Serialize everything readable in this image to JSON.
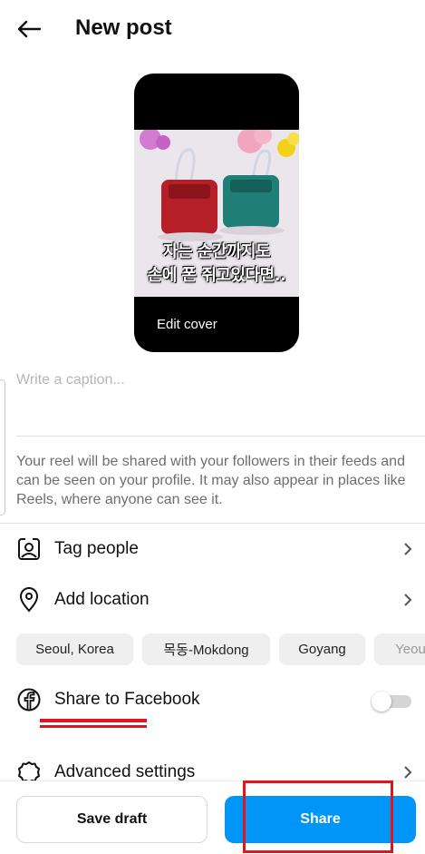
{
  "header": {
    "title": "New post",
    "back_icon": "arrow-left-icon"
  },
  "cover": {
    "overlay_line1": "자는 순간까지도",
    "overlay_line2": "손에 폰 쥐고있다면..",
    "edit_label": "Edit cover"
  },
  "caption": {
    "placeholder": "Write a caption..."
  },
  "info_text": "Your reel will be shared with your followers in their feeds and can be seen on your profile. It may also appear in places like Reels, where anyone can see it.",
  "options": {
    "tag_people": {
      "label": "Tag people",
      "icon": "tag-person-icon"
    },
    "add_location": {
      "label": "Add location",
      "icon": "location-pin-icon"
    },
    "share_facebook": {
      "label": "Share to Facebook",
      "icon": "facebook-icon",
      "toggle_on": false
    },
    "advanced": {
      "label": "Advanced settings",
      "icon": "gear-icon"
    }
  },
  "location_suggestions": [
    "Seoul, Korea",
    "목동-Mokdong",
    "Goyang",
    "Yeou"
  ],
  "buttons": {
    "save_draft": "Save draft",
    "share": "Share"
  },
  "colors": {
    "accent": "#0095f6",
    "annotation_red": "#e0161e"
  }
}
